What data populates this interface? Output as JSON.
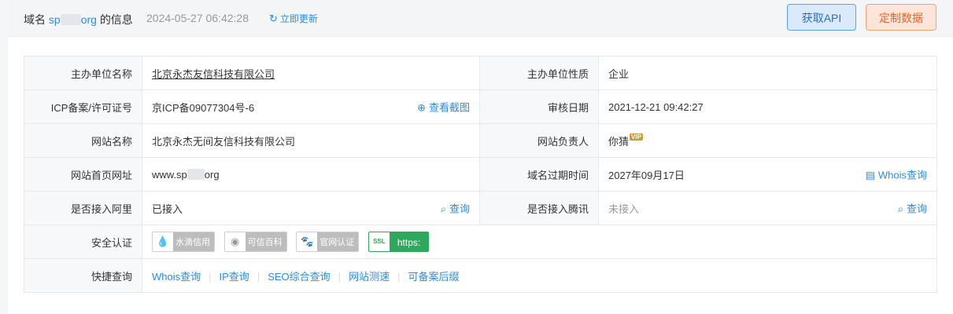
{
  "header": {
    "prefix": "域名",
    "domain_start": "sp",
    "domain_end": "org",
    "suffix": "的信息",
    "time": "2024-05-27 06:42:28",
    "refresh_label": "立即更新",
    "api_button": "获取API",
    "custom_button": "定制数据"
  },
  "rows": {
    "org_name": {
      "label": "主办单位名称",
      "value": "北京永杰友信科技有限公司"
    },
    "org_type": {
      "label": "主办单位性质",
      "value": "企业"
    },
    "icp": {
      "label": "ICP备案/许可证号",
      "value": "京ICP备09077304号-6",
      "action": "查看截图"
    },
    "audit_date": {
      "label": "审核日期",
      "value": "2021-12-21 09:42:27"
    },
    "site_name": {
      "label": "网站名称",
      "value": "北京永杰无间友信科技有限公司"
    },
    "site_owner": {
      "label": "网站负责人",
      "value": "你猜",
      "vip": "VIP"
    },
    "homepage": {
      "label": "网站首页网址",
      "value_start": "www.sp",
      "value_end": "org"
    },
    "expire": {
      "label": "域名过期时间",
      "value": "2027年09月17日",
      "action": "Whois查询"
    },
    "ali": {
      "label": "是否接入阿里",
      "value": "已接入",
      "action": "查询"
    },
    "tencent": {
      "label": "是否接入腾讯",
      "value": "未接入",
      "action": "查询"
    },
    "security": {
      "label": "安全认证",
      "badges": [
        "水滴信用",
        "可信百科",
        "官网认证",
        "https:"
      ],
      "ssl_icon_text": "SSL"
    },
    "quick": {
      "label": "快捷查询",
      "links": [
        "Whois查询",
        "IP查询",
        "SEO综合查询",
        "网站测速",
        "可备案后缀"
      ]
    }
  },
  "colors": {
    "link": "#2d8be0",
    "api_bg": "#dbeafb",
    "custom_bg": "#fde6d9",
    "ssl": "#2ea85c"
  }
}
